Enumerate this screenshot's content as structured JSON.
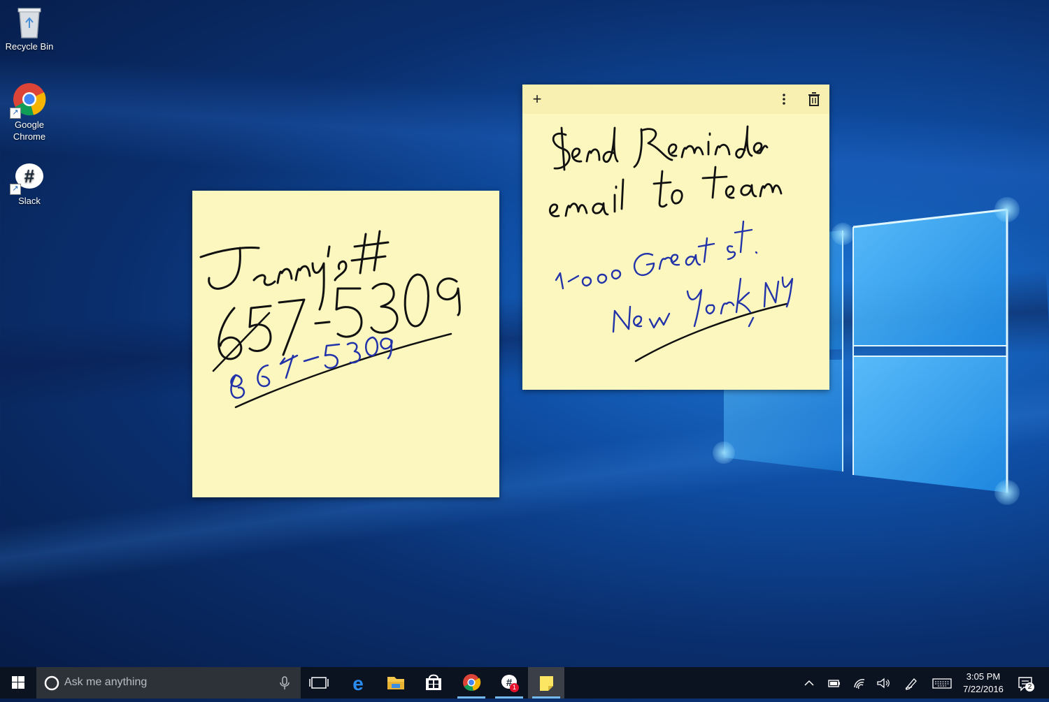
{
  "desktop": {
    "icons": [
      {
        "label": "Recycle Bin",
        "icon": "recycle-bin-icon"
      },
      {
        "label": "Google\nChrome",
        "icon": "chrome-icon"
      },
      {
        "label": "Slack",
        "icon": "slack-icon"
      }
    ]
  },
  "notes": [
    {
      "id": "note-jenny",
      "handwriting": [
        "Jenny's #",
        "657-5309",
        "867-5309"
      ],
      "ink_colors": {
        "black": "#111111",
        "blue": "#2233aa"
      }
    },
    {
      "id": "note-reminder",
      "toolbar": {
        "add_icon": "plus-icon",
        "menu_icon": "more-vertical-icon",
        "delete_icon": "trash-icon"
      },
      "handwriting": [
        "Send Reminder",
        "email to team",
        "1000 Great st.",
        "New York, NY"
      ]
    }
  ],
  "taskbar": {
    "search_placeholder": "Ask me anything",
    "apps": [
      "task-view-icon",
      "edge-icon",
      "file-explorer-icon",
      "store-icon",
      "chrome-icon",
      "slack-icon",
      "sticky-notes-icon"
    ],
    "slack_badge": "1",
    "clock_time": "3:05 PM",
    "clock_date": "7/22/2016",
    "notification_count": "2"
  },
  "colors": {
    "note_bg": "#fcf7bf",
    "taskbar": "#0b1220",
    "accent": "#76b9ed"
  }
}
